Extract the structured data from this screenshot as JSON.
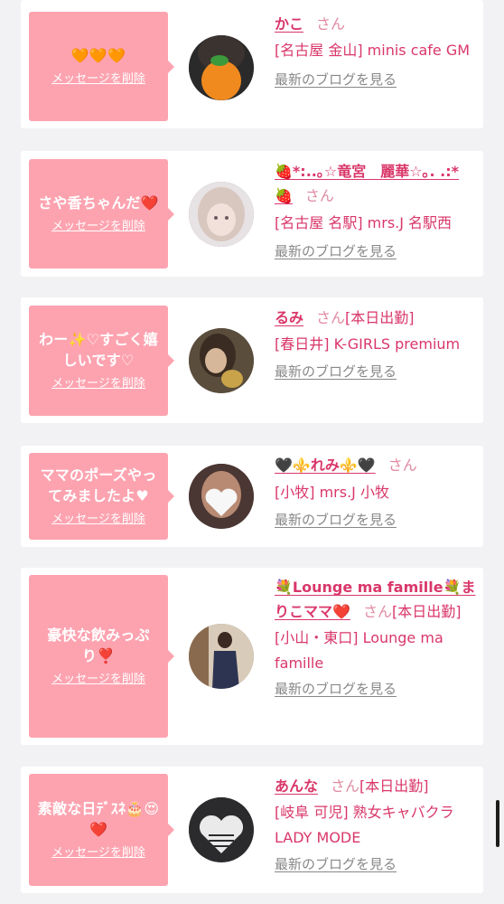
{
  "colors": {
    "bubble": "#fda3b0",
    "name": "#d9376a",
    "san": "#e08aa2",
    "blog_link": "#888888",
    "page_bg": "#f2f2f4"
  },
  "entries": [
    {
      "message": "🧡🧡🧡",
      "delete_label": "メッセージを削除",
      "name": "かこ",
      "honorific": "さん",
      "status": "",
      "shop": "[名古屋 金山] minis cafe GM",
      "blog_label": "最新のブログを見る",
      "avatar": "avatar-orange-emoji"
    },
    {
      "message": "さや香ちゃんだ❤️",
      "delete_label": "メッセージを削除",
      "name": "🍓*:..｡☆竜宮　麗華☆｡. .:* 🍓",
      "honorific": "さん",
      "status": "",
      "shop": "[名古屋 名駅] mrs.J 名駅西",
      "blog_label": "最新のブログを見る",
      "avatar": "avatar-blonde"
    },
    {
      "message": "わー✨♡すごく嬉しいです♡",
      "delete_label": "メッセージを削除",
      "name": "るみ",
      "honorific": "さん",
      "status": "[本日出勤]",
      "shop": "[春日井] K-GIRLS premium",
      "blog_label": "最新のブログを見る",
      "avatar": "avatar-brown-hair"
    },
    {
      "message": "ママのポーズやってみましたよ♥",
      "delete_label": "メッセージを削除",
      "name": "🖤⚜️れみ⚜️🖤",
      "honorific": "さん",
      "status": "",
      "shop": "[小牧] mrs.J 小牧",
      "blog_label": "最新のブログを見る",
      "avatar": "avatar-heart-sticker"
    },
    {
      "message": "豪快な飲みっぷり❣️",
      "delete_label": "メッセージを削除",
      "name": "💐Lounge ma famille💐まりこママ❤️",
      "honorific": "さん",
      "status": "[本日出勤]",
      "shop": "[小山・東口] Lounge ma famille",
      "blog_label": "最新のブログを見る",
      "avatar": "avatar-kimono"
    },
    {
      "message": "素敵な日ﾃﾞｽﾈ🎂😍❤️",
      "delete_label": "メッセージを削除",
      "name": "あんな",
      "honorific": "さん",
      "status": "[本日出勤]",
      "shop": "[岐阜 可児] 熟女キャバクラ LADY MODE",
      "blog_label": "最新のブログを見る",
      "avatar": "avatar-dark-heart"
    }
  ]
}
